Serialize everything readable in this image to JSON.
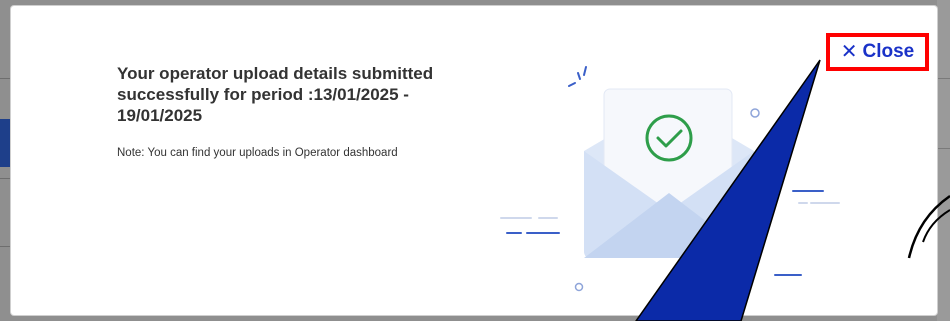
{
  "modal": {
    "headline": "Your operator upload details submitted successfully for period :13/01/2025 - 19/01/2025",
    "note": "Note: You can find your uploads in Operator dashboard",
    "close_label": "Close",
    "close_icon": "close-icon"
  },
  "colors": {
    "close_text": "#1a32c8",
    "highlight_border": "#ff0000",
    "annotation_fill": "#0b2aa8",
    "check_green": "#2e9e4a",
    "envelope_light": "#dde7f7",
    "envelope_mid": "#c3d4f0",
    "accent_lines": "#3a5fc8"
  }
}
